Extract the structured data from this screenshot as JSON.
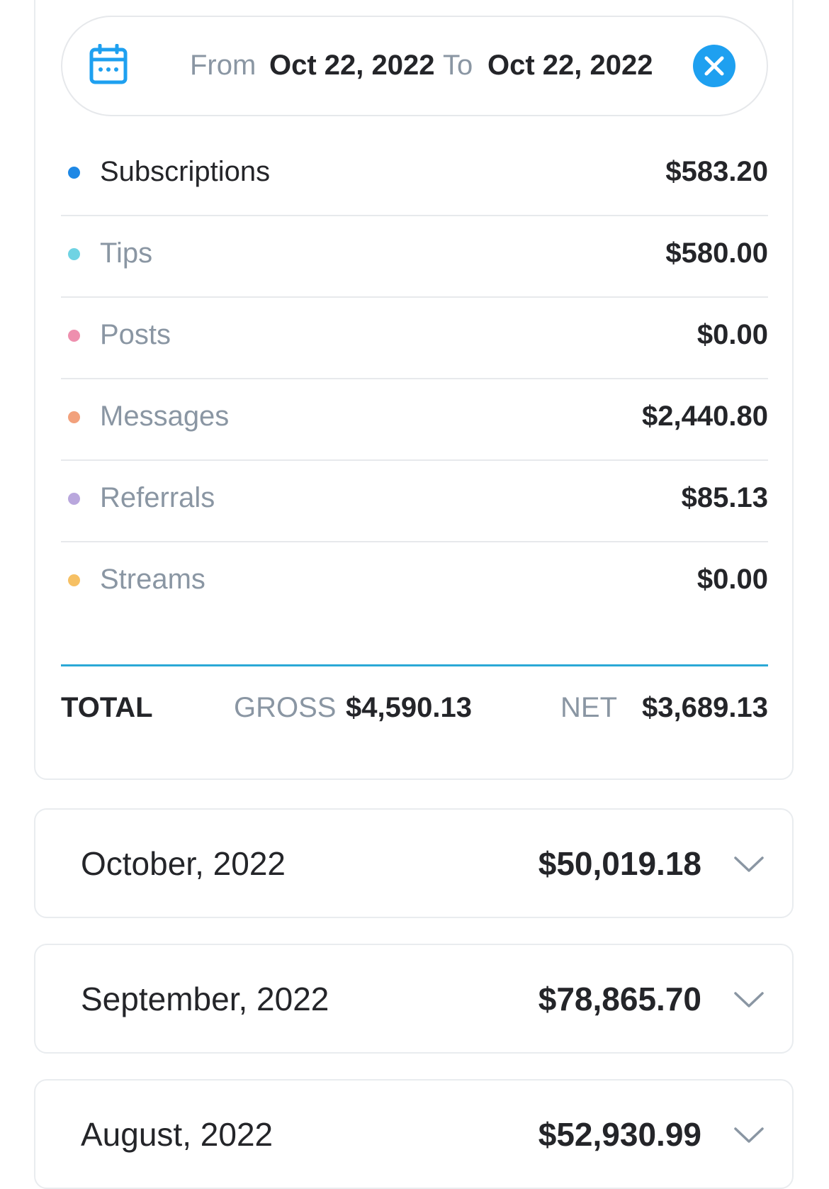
{
  "date_range": {
    "from_label": "From",
    "from_value": "Oct 22, 2022",
    "to_label": "To",
    "to_value": "Oct 22, 2022",
    "calendar_icon": "calendar-icon",
    "clear_icon": "close-icon"
  },
  "categories": [
    {
      "label": "Subscriptions",
      "amount": "$583.20",
      "color": "#1e88e5"
    },
    {
      "label": "Tips",
      "amount": "$580.00",
      "color": "#6fd3e3"
    },
    {
      "label": "Posts",
      "amount": "$0.00",
      "color": "#ee8fae"
    },
    {
      "label": "Messages",
      "amount": "$2,440.80",
      "color": "#f2a17c"
    },
    {
      "label": "Referrals",
      "amount": "$85.13",
      "color": "#b9a7dd"
    },
    {
      "label": "Streams",
      "amount": "$0.00",
      "color": "#f6c064"
    }
  ],
  "total": {
    "label": "TOTAL",
    "gross_label": "GROSS",
    "gross_value": "$4,590.13",
    "net_label": "NET",
    "net_value": "$3,689.13"
  },
  "months": [
    {
      "label": "October, 2022",
      "amount": "$50,019.18"
    },
    {
      "label": "September, 2022",
      "amount": "$78,865.70"
    },
    {
      "label": "August, 2022",
      "amount": "$52,930.99"
    }
  ],
  "colors": {
    "accent": "#1ea0f0",
    "total_divider": "#2ba8d6"
  }
}
